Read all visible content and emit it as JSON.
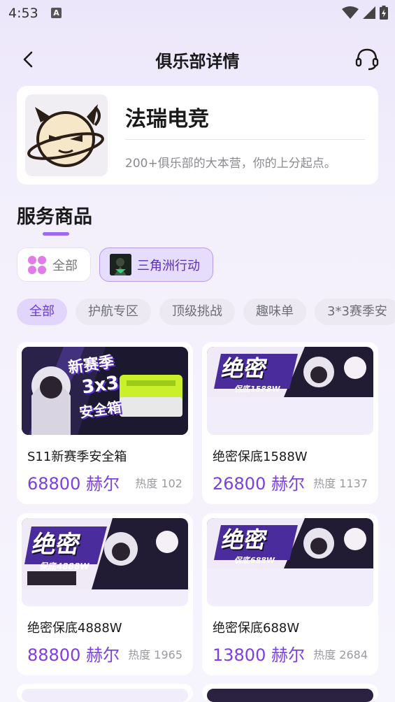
{
  "status_bar": {
    "time": "4:53",
    "a_badge": "A"
  },
  "header": {
    "title": "俱乐部详情"
  },
  "club": {
    "name": "法瑞电竞",
    "description": "200+俱乐部的大本营，你的上分起点。"
  },
  "section": {
    "title": "服务商品"
  },
  "game_filters": [
    {
      "label": "全部",
      "selected": false
    },
    {
      "label": "三角洲行动",
      "selected": true
    }
  ],
  "category_tabs": [
    {
      "label": "全部",
      "active": true
    },
    {
      "label": "护航专区",
      "active": false
    },
    {
      "label": "顶级挑战",
      "active": false
    },
    {
      "label": "趣味单",
      "active": false
    },
    {
      "label": "3*3赛季安",
      "active": false
    }
  ],
  "products": [
    {
      "name": "S11新赛季安全箱",
      "price": "68800 赫尔",
      "heat": "热度 102",
      "banner_lines": [
        "新赛季",
        "3x3",
        "安全箱"
      ]
    },
    {
      "name": "绝密保底1588W",
      "price": "26800 赫尔",
      "heat": "热度 1137",
      "banner_lines": [
        "绝密",
        "保底1588W"
      ]
    },
    {
      "name": "绝密保底4888W",
      "price": "88800 赫尔",
      "heat": "热度 1965",
      "banner_lines": [
        "绝密",
        "保底4888W"
      ]
    },
    {
      "name": "绝密保底688W",
      "price": "13800 赫尔",
      "heat": "热度 2684",
      "banner_lines": [
        "绝密",
        "保底688W"
      ]
    }
  ],
  "colors": {
    "accent": "#7B3FE4",
    "chip_active_bg": "#E2D5FB",
    "background": "#F3F0FC"
  },
  "icons": {
    "back": "chevron-left-icon",
    "support": "headset-icon",
    "all_games": "grid-dots-icon"
  }
}
